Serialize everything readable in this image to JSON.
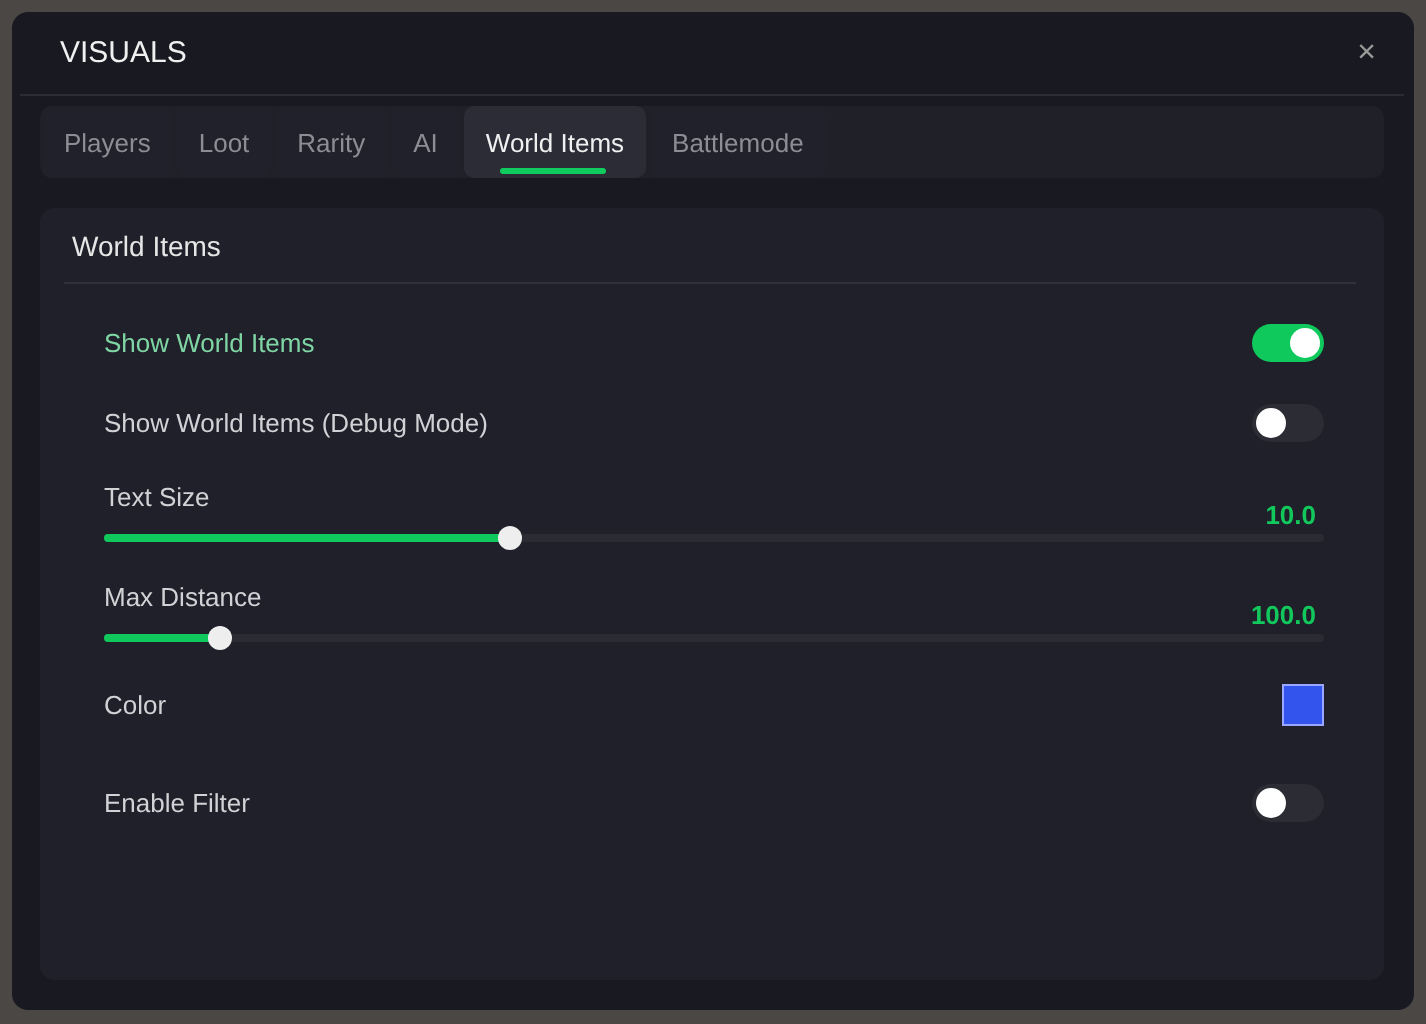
{
  "window": {
    "title": "VISUALS",
    "close": "×"
  },
  "tabs": [
    {
      "label": "Players",
      "selected": false
    },
    {
      "label": "Loot",
      "selected": false
    },
    {
      "label": "Rarity",
      "selected": false
    },
    {
      "label": "AI",
      "selected": false
    },
    {
      "label": "World Items",
      "selected": true
    },
    {
      "label": "Battlemode",
      "selected": false
    }
  ],
  "panel": {
    "title": "World Items",
    "settings": [
      {
        "kind": "toggle",
        "label": "Show World Items",
        "on": true
      },
      {
        "kind": "toggle",
        "label": "Show World Items (Debug Mode)",
        "on": false
      },
      {
        "kind": "slider",
        "label": "Text Size",
        "reading": "10.0",
        "level": 0.332
      },
      {
        "kind": "slider",
        "label": "Max Distance",
        "reading": "100.0",
        "level": 0.095
      },
      {
        "kind": "color",
        "label": "Color",
        "color": "#3355ee"
      },
      {
        "kind": "toggle",
        "label": "Enable Filter",
        "on": false
      }
    ]
  }
}
